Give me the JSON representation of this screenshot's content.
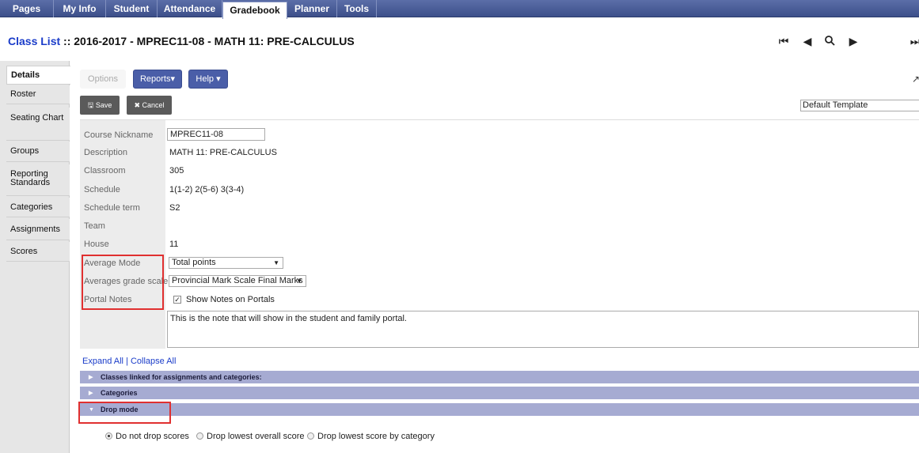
{
  "nav": {
    "tabs": [
      "Pages",
      "My Info",
      "Student",
      "Attendance",
      "Gradebook",
      "Planner",
      "Tools"
    ],
    "active": "Gradebook"
  },
  "title": {
    "link": "Class List",
    "rest": " :: 2016-2017 - MPREC11-08 - MATH 11: PRE-CALCULUS"
  },
  "record_nav": [
    "first-record-icon",
    "previous-record-icon",
    "search-icon",
    "next-record-icon",
    "last-record-icon"
  ],
  "sidebar": [
    {
      "label": "Details",
      "active": true
    },
    {
      "label": "Roster"
    },
    {
      "label": "Seating Chart"
    },
    {
      "label": "Groups"
    },
    {
      "label": "Reporting Standards"
    },
    {
      "label": "Categories"
    },
    {
      "label": "Assignments"
    },
    {
      "label": "Scores"
    }
  ],
  "toolbar": {
    "options": "Options",
    "reports": "Reports▾",
    "help": "Help ▾",
    "save": "Save",
    "cancel": "Cancel",
    "template": "Default Template"
  },
  "form": {
    "nickname_label": "Course Nickname",
    "nickname_value": "MPREC11-08",
    "description_label": "Description",
    "description_value": "MATH 11: PRE-CALCULUS",
    "classroom_label": "Classroom",
    "classroom_value": "305",
    "schedule_label": "Schedule",
    "schedule_value": "1(1-2) 2(5-6) 3(3-4)",
    "term_label": "Schedule term",
    "term_value": "S2",
    "team_label": "Team",
    "team_value": "",
    "house_label": "House",
    "house_value": "11",
    "avg_mode_label": "Average Mode",
    "avg_mode_value": "Total points",
    "avg_scale_label": "Averages grade scale",
    "avg_scale_value": "Provincial Mark Scale Final Marks",
    "portal_label": "Portal Notes",
    "portal_checkbox_label": "Show Notes on Portals",
    "portal_checked": true,
    "portal_note": "This is the note that will show in the student and family portal."
  },
  "expand_all": "Expand All",
  "separator": "|",
  "collapse_all": "Collapse All",
  "sections": [
    {
      "label": "Classes linked for assignments and categories:",
      "expanded": false
    },
    {
      "label": "Categories",
      "expanded": false
    },
    {
      "label": "Drop mode",
      "expanded": true
    }
  ],
  "drop_mode": {
    "options": [
      "Do not drop scores",
      "Drop lowest overall score",
      "Drop lowest score by category"
    ],
    "selected": "Do not drop scores"
  },
  "colors": {
    "nav": "#3d4f8a",
    "link": "#1a3cc9",
    "section": "#a6abd2",
    "highlight": "#e03030"
  }
}
